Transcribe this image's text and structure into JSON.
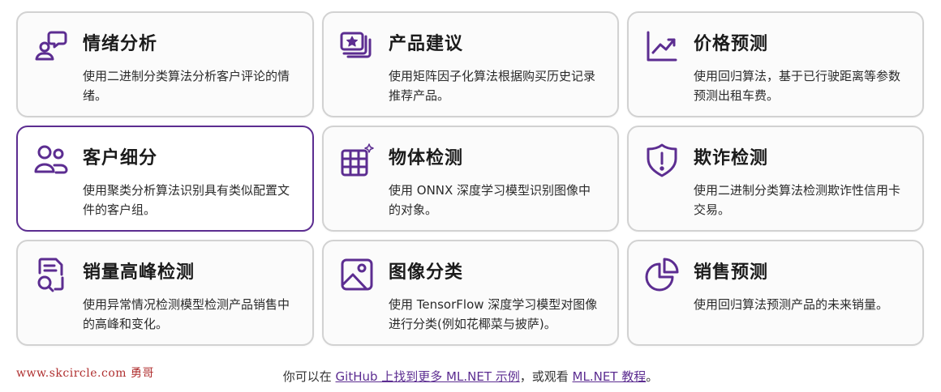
{
  "accent_color": "#5c2d91",
  "cards": [
    {
      "title": "情绪分析",
      "desc": "使用二进制分类算法分析客户评论的情绪。",
      "icon": "chat-bubbles-icon"
    },
    {
      "title": "产品建议",
      "desc": "使用矩阵因子化算法根据购买历史记录推荐产品。",
      "icon": "stacked-star-cards-icon"
    },
    {
      "title": "价格预测",
      "desc": "使用回归算法，基于已行驶距离等参数预测出租车费。",
      "icon": "trend-chart-icon"
    },
    {
      "title": "客户细分",
      "desc": "使用聚类分析算法识别具有类似配置文件的客户组。",
      "icon": "people-group-icon"
    },
    {
      "title": "物体检测",
      "desc": "使用 ONNX 深度学习模型识别图像中的对象。",
      "icon": "grid-sparkle-icon"
    },
    {
      "title": "欺诈检测",
      "desc": "使用二进制分类算法检测欺诈性信用卡交易。",
      "icon": "shield-alert-icon"
    },
    {
      "title": "销量高峰检测",
      "desc": "使用异常情况检测模型检测产品销售中的高峰和变化。",
      "icon": "document-search-icon"
    },
    {
      "title": "图像分类",
      "desc": "使用 TensorFlow 深度学习模型对图像进行分类(例如花椰菜与披萨)。",
      "icon": "image-icon"
    },
    {
      "title": "销售预测",
      "desc": "使用回归算法预测产品的未来销量。",
      "icon": "pie-chart-icon"
    }
  ],
  "watermark": "www.skcircle.com 勇哥",
  "footer": {
    "prefix": "你可以在 ",
    "link1": "GitHub 上找到更多 ML.NET 示例",
    "middle": "，或观看 ",
    "link2": "ML.NET 教程",
    "suffix": "。"
  }
}
